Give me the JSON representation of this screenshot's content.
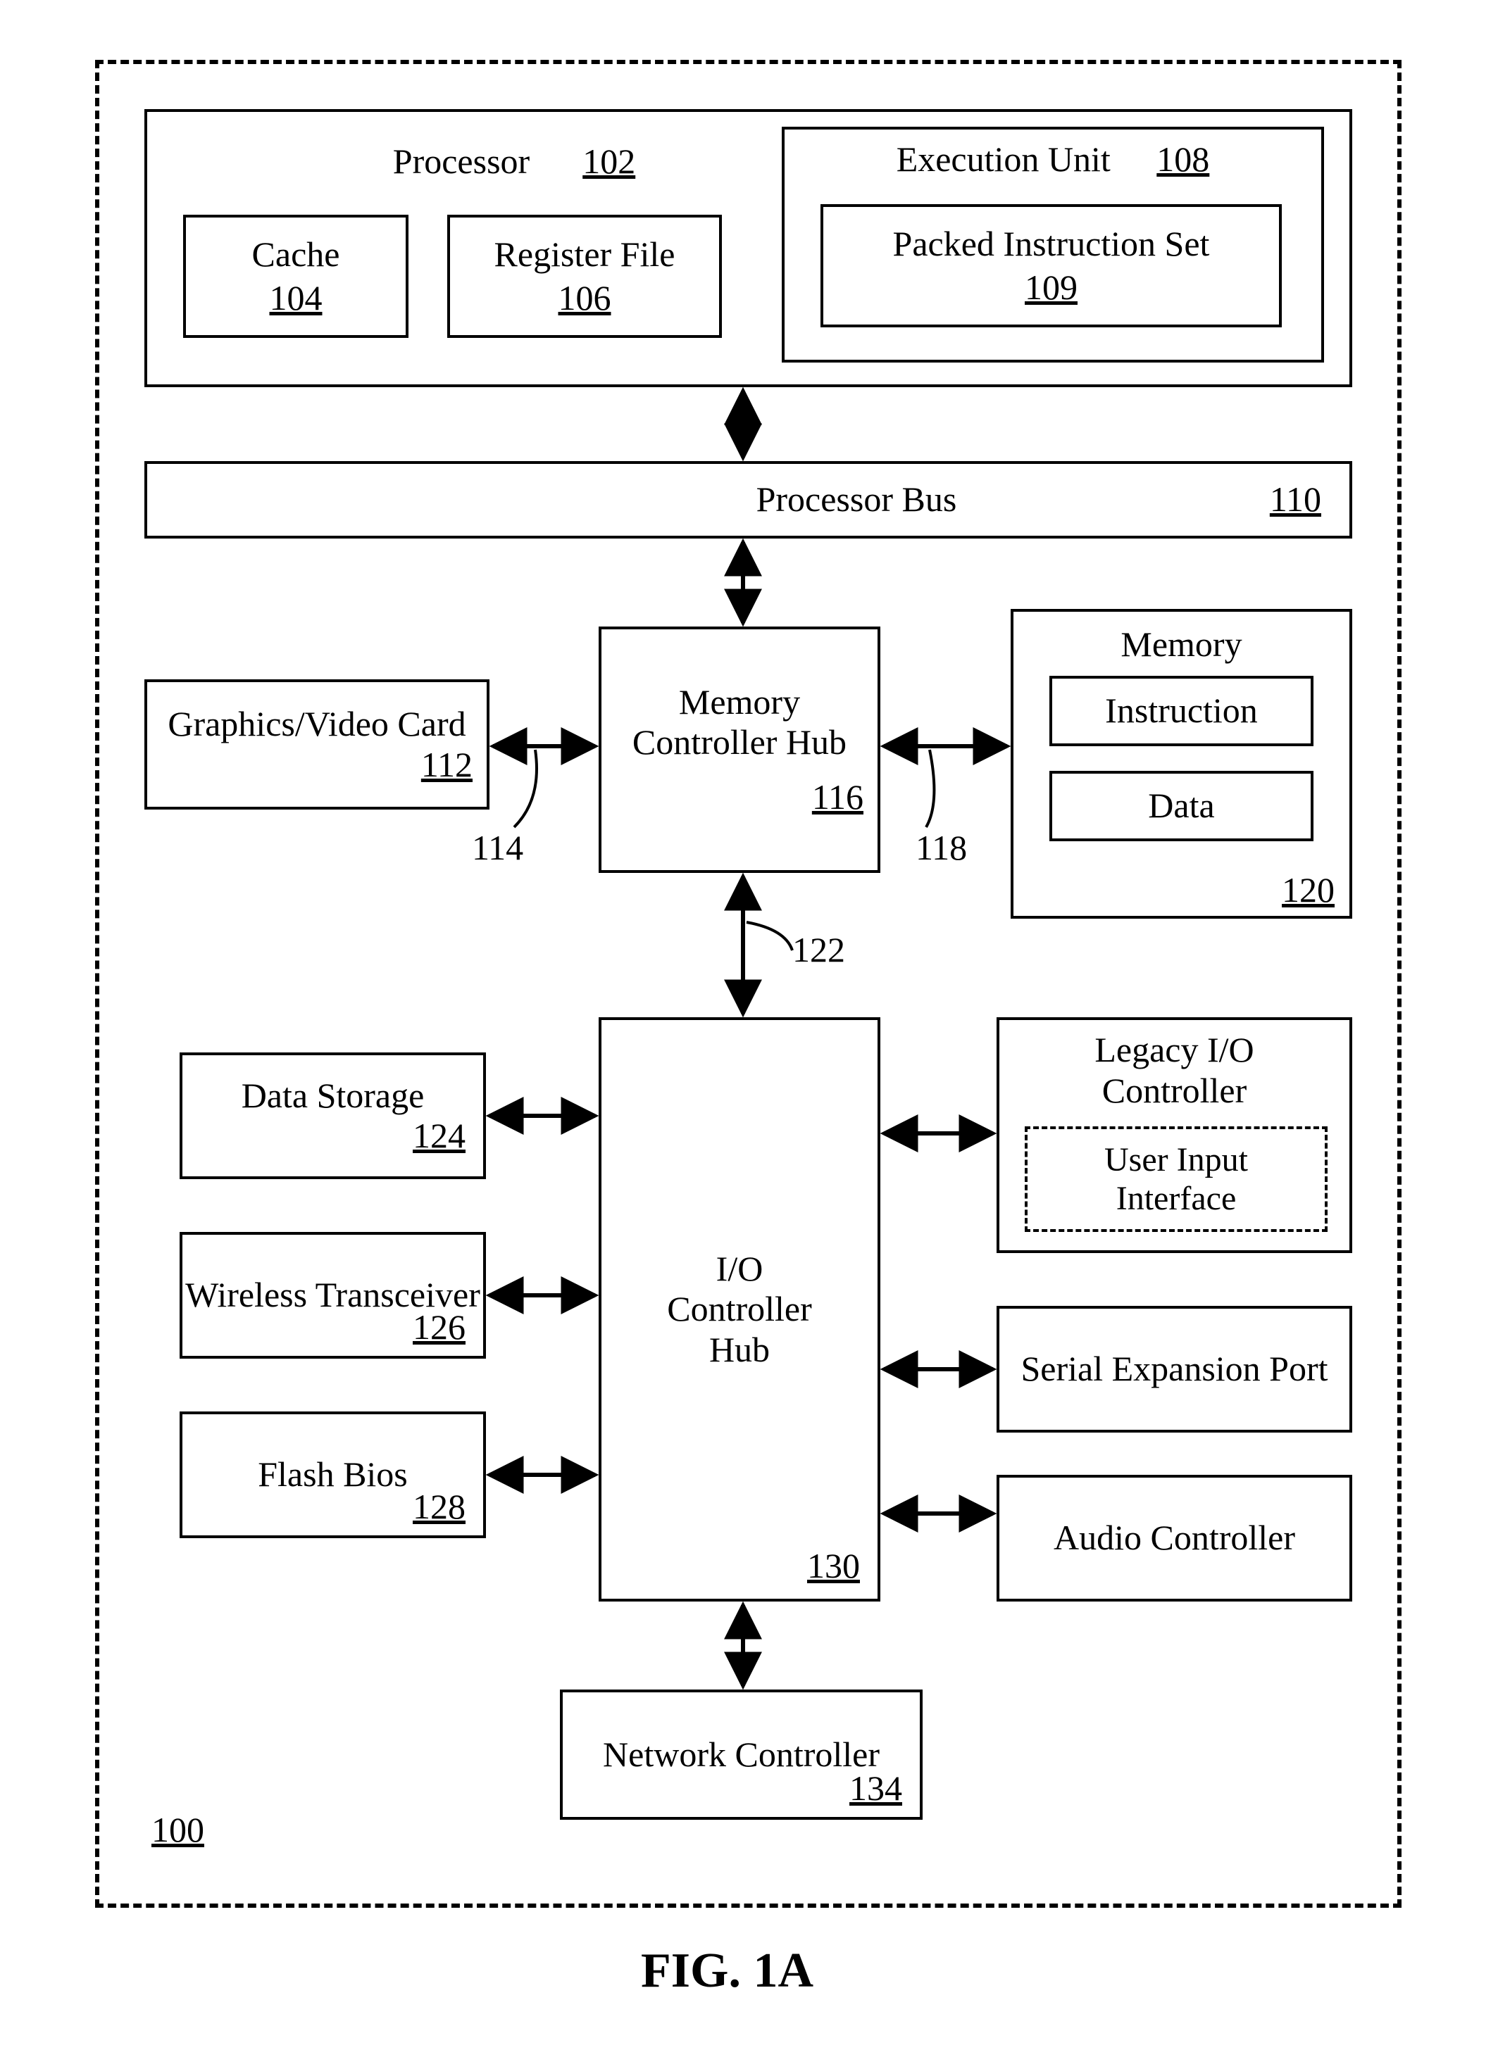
{
  "figure": "FIG. 1A",
  "system_ref": "100",
  "processor": {
    "label": "Processor",
    "ref": "102"
  },
  "cache": {
    "label": "Cache",
    "ref": "104"
  },
  "regfile": {
    "label": "Register File",
    "ref": "106"
  },
  "execunit": {
    "label": "Execution Unit",
    "ref": "108"
  },
  "packed": {
    "label": "Packed Instruction Set",
    "ref": "109"
  },
  "procbus": {
    "label": "Processor Bus",
    "ref": "110"
  },
  "gfx": {
    "label": "Graphics/Video Card",
    "ref": "112"
  },
  "bus114": "114",
  "mch": {
    "label": "Memory Controller Hub",
    "ref": "116"
  },
  "bus118": "118",
  "memory": {
    "label": "Memory",
    "instruction": "Instruction",
    "data": "Data",
    "ref": "120"
  },
  "bus122": "122",
  "datastorage": {
    "label": "Data Storage",
    "ref": "124"
  },
  "wireless": {
    "label": "Wireless Transceiver",
    "ref": "126"
  },
  "flash": {
    "label": "Flash Bios",
    "ref": "128"
  },
  "ich": {
    "label": "I/O Controller Hub",
    "ref": "130"
  },
  "legacy": {
    "label": "Legacy I/O Controller",
    "user": "User Input Interface"
  },
  "serial": {
    "label": "Serial Expansion Port"
  },
  "audio": {
    "label": "Audio Controller"
  },
  "netctrl": {
    "label": "Network Controller",
    "ref": "134"
  }
}
